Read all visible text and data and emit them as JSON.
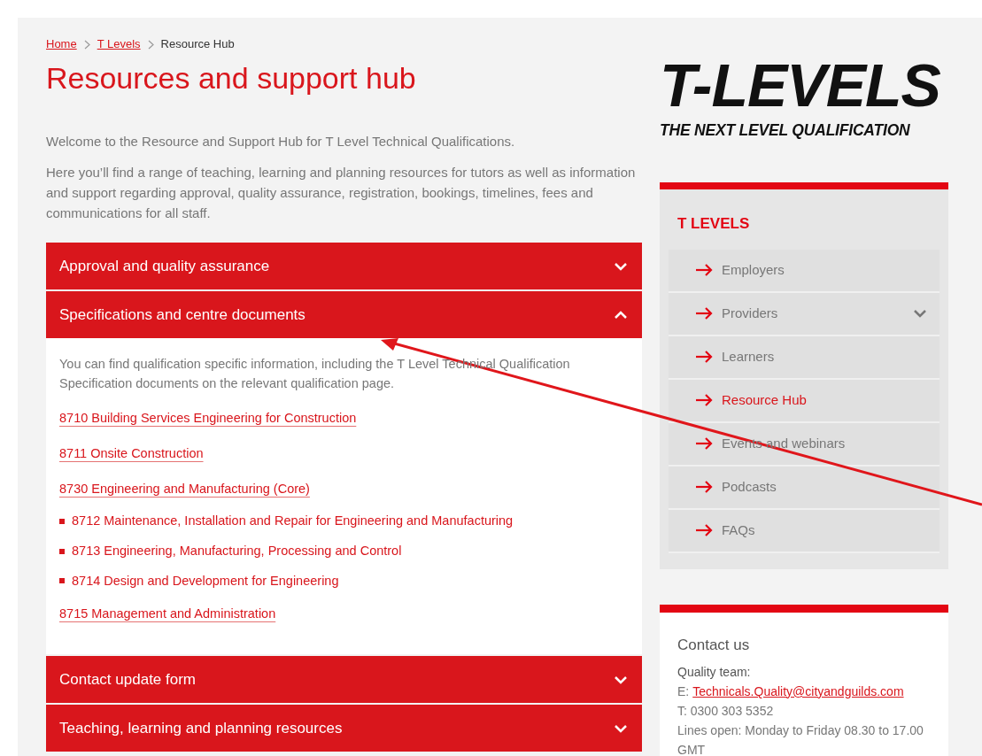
{
  "breadcrumb": [
    {
      "label": "Home",
      "link": true
    },
    {
      "label": "T Levels",
      "link": true
    },
    {
      "label": "Resource Hub",
      "link": false
    }
  ],
  "title": "Resources and support hub",
  "intro": [
    "Welcome to the Resource and Support Hub for T Level Technical Qualifications.",
    "Here you’ll find a range of teaching, learning and planning resources for tutors as well as information and support regarding approval, quality assurance, registration, bookings, timelines, fees and communications for all staff."
  ],
  "accordion": [
    {
      "title": "Approval and quality assurance",
      "expanded": false
    },
    {
      "title": "Specifications and centre documents",
      "expanded": true,
      "content": {
        "text": "You can find qualification specific information, including the T Level Technical Qualification Specification documents on the relevant qualification page.",
        "links": [
          {
            "label": "8710 Building Services Engineering for Construction",
            "kind": "link"
          },
          {
            "label": "8711 Onsite Construction",
            "kind": "link"
          },
          {
            "label": "8730 Engineering and Manufacturing (Core)",
            "kind": "link"
          },
          {
            "label": "8712 Maintenance, Installation and Repair for Engineering and Manufacturing",
            "kind": "bullet"
          },
          {
            "label": "8713 Engineering, Manufacturing, Processing and Control",
            "kind": "bullet"
          },
          {
            "label": "8714 Design and Development for Engineering",
            "kind": "bullet"
          },
          {
            "label": "8715 Management and Administration",
            "kind": "link"
          }
        ]
      }
    },
    {
      "title": "Contact update form",
      "expanded": false
    },
    {
      "title": "Teaching, learning and planning resources",
      "expanded": false
    }
  ],
  "logo": {
    "wordmark": "T-LEVELS",
    "tagline": "THE NEXT LEVEL QUALIFICATION"
  },
  "sidebar": {
    "heading": "T LEVELS",
    "items": [
      {
        "label": "Employers",
        "selected": false,
        "expandable": false
      },
      {
        "label": "Providers",
        "selected": false,
        "expandable": true
      },
      {
        "label": "Learners",
        "selected": false,
        "expandable": false
      },
      {
        "label": "Resource Hub",
        "selected": true,
        "expandable": false
      },
      {
        "label": "Events and webinars",
        "selected": false,
        "expandable": false
      },
      {
        "label": "Podcasts",
        "selected": false,
        "expandable": false
      },
      {
        "label": "FAQs",
        "selected": false,
        "expandable": false
      }
    ]
  },
  "contact": {
    "heading": "Contact us",
    "team": "Quality team:",
    "email_label": "E:",
    "email": "Technicals.Quality@cityandguilds.com",
    "phone": "T: 0300 303 5352",
    "hours": "Lines open: Monday to Friday 08.30 to 17.00 GMT"
  }
}
